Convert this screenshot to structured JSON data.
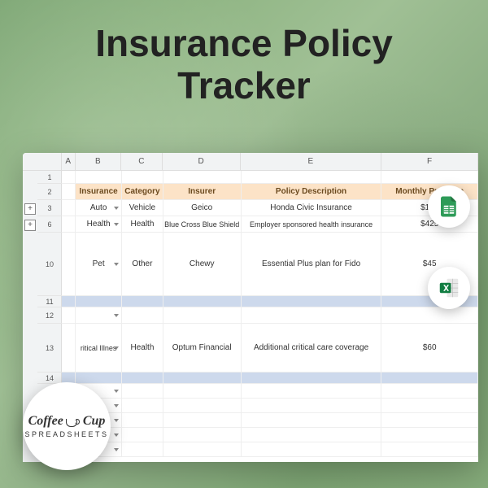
{
  "title_line1": "Insurance Policy",
  "title_line2": "Tracker",
  "columns": {
    "A": "A",
    "B": "B",
    "C": "C",
    "D": "D",
    "E": "E",
    "F": "F"
  },
  "header": {
    "insurance": "Insurance",
    "category": "Category",
    "insurer": "Insurer",
    "policy": "Policy Description",
    "premium": "Monthly Premium"
  },
  "rows": [
    {
      "num": "3",
      "insurance": "Auto",
      "category": "Vehicle",
      "insurer": "Geico",
      "policy": "Honda Civic Insurance",
      "premium": "$131"
    },
    {
      "num": "6",
      "insurance": "Health",
      "category": "Health",
      "insurer": "Blue Cross Blue Shield",
      "policy": "Employer sponsored health insurance",
      "premium": "$425"
    },
    {
      "num": "10",
      "insurance": "Pet",
      "category": "Other",
      "insurer": "Chewy",
      "policy": "Essential Plus plan for Fido",
      "premium": "$45"
    },
    {
      "num": "13",
      "insurance": "ritical Illnes",
      "category": "Health",
      "insurer": "Optum Financial",
      "policy": "Additional critical care coverage",
      "premium": "$60"
    }
  ],
  "rownums_extra": [
    "1",
    "2",
    "11",
    "12",
    "14"
  ],
  "toggles": [
    "+",
    "+"
  ],
  "logo": {
    "line1": "Coffee",
    "line1b": "Cup",
    "line2": "SPREADSHEETS"
  },
  "badges": {
    "sheets": "google-sheets-icon",
    "excel": "excel-icon"
  }
}
